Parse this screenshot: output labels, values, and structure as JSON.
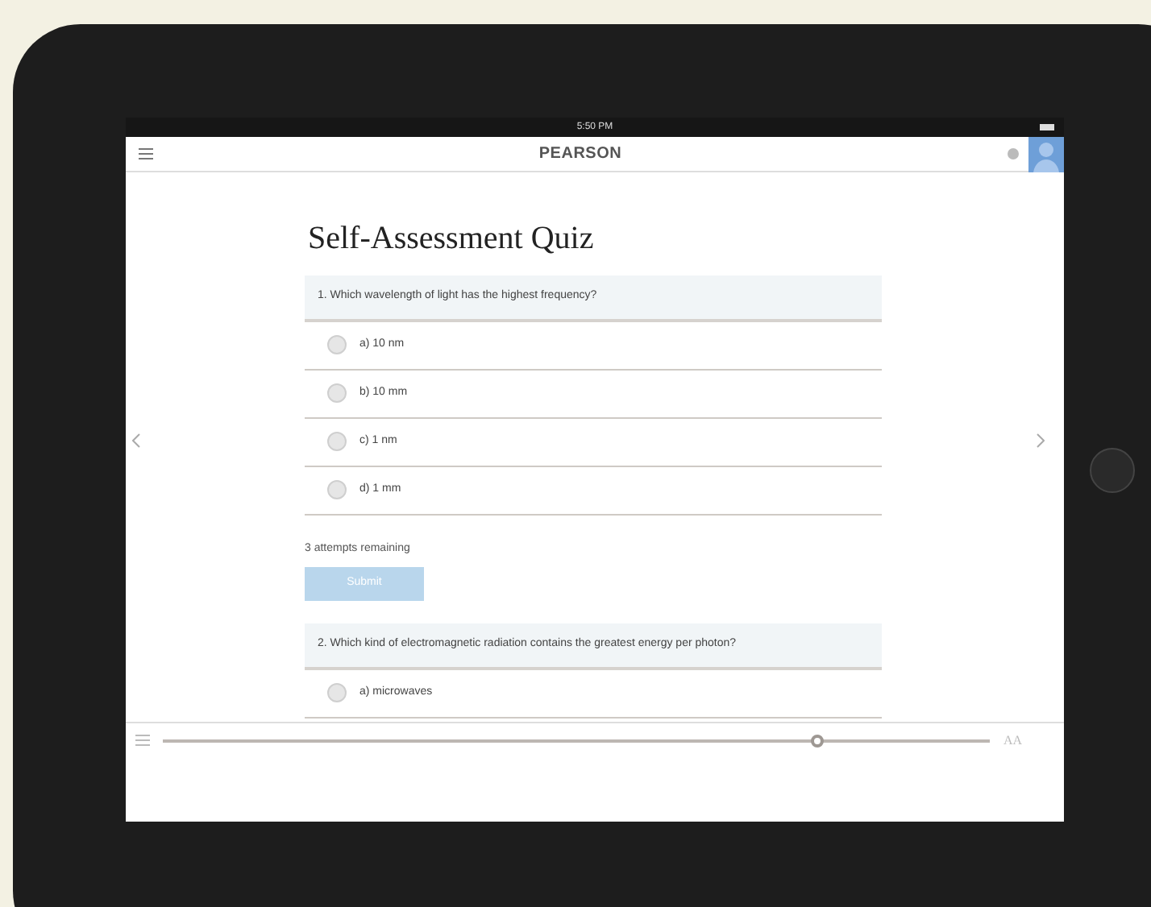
{
  "status_bar": {
    "time": "5:50 PM"
  },
  "header": {
    "title": "PEARSON"
  },
  "quiz": {
    "title": "Self-Assessment Quiz",
    "questions": [
      {
        "text": "1. Which wavelength of light has the highest frequency?",
        "options": [
          {
            "label": "a) 10 nm",
            "selected": false
          },
          {
            "label": "b) 10 mm",
            "selected": false
          },
          {
            "label": "c) 1 nm",
            "selected": false
          },
          {
            "label": "d) 1 mm",
            "selected": false
          }
        ],
        "attempts": "3 attempts remaining",
        "submit": {
          "label": "Submit",
          "disabled": true
        }
      },
      {
        "text": "2. Which kind of electromagnetic radiation contains the greatest energy per photon?",
        "options": [
          {
            "label": "a) microwaves",
            "selected": false
          }
        ]
      }
    ]
  },
  "toolbar": {
    "progress": {
      "level": 0.79
    },
    "font_button": "AA"
  }
}
